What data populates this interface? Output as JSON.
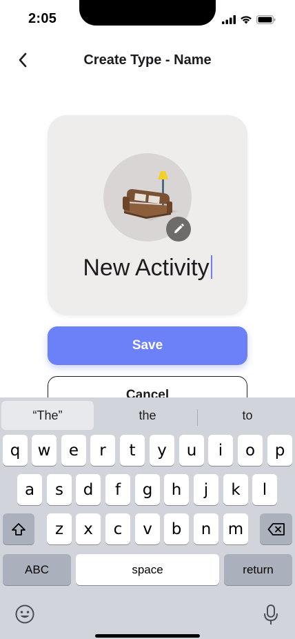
{
  "status_bar": {
    "time": "2:05"
  },
  "header": {
    "title": "Create Type - Name"
  },
  "card": {
    "name_value": "New Activity"
  },
  "buttons": {
    "save_label": "Save",
    "cancel_label": "Cancel"
  },
  "keyboard": {
    "suggestions": [
      "“The”",
      "the",
      "to"
    ],
    "row1": [
      "q",
      "w",
      "e",
      "r",
      "t",
      "y",
      "u",
      "i",
      "o",
      "p"
    ],
    "row2": [
      "a",
      "s",
      "d",
      "f",
      "g",
      "h",
      "j",
      "k",
      "l"
    ],
    "row3": [
      "z",
      "x",
      "c",
      "v",
      "b",
      "n",
      "m"
    ],
    "abc_label": "ABC",
    "space_label": "space",
    "return_label": "return"
  },
  "colors": {
    "accent": "#6c80f7",
    "card_bg": "#efedec",
    "keyboard_bg": "#d1d4db"
  },
  "icons": [
    "back-chevron-icon",
    "signal-icon",
    "wifi-icon",
    "battery-icon",
    "pencil-icon",
    "sofa-lamp-illustration",
    "shift-icon",
    "backspace-icon",
    "emoji-icon",
    "microphone-icon"
  ]
}
